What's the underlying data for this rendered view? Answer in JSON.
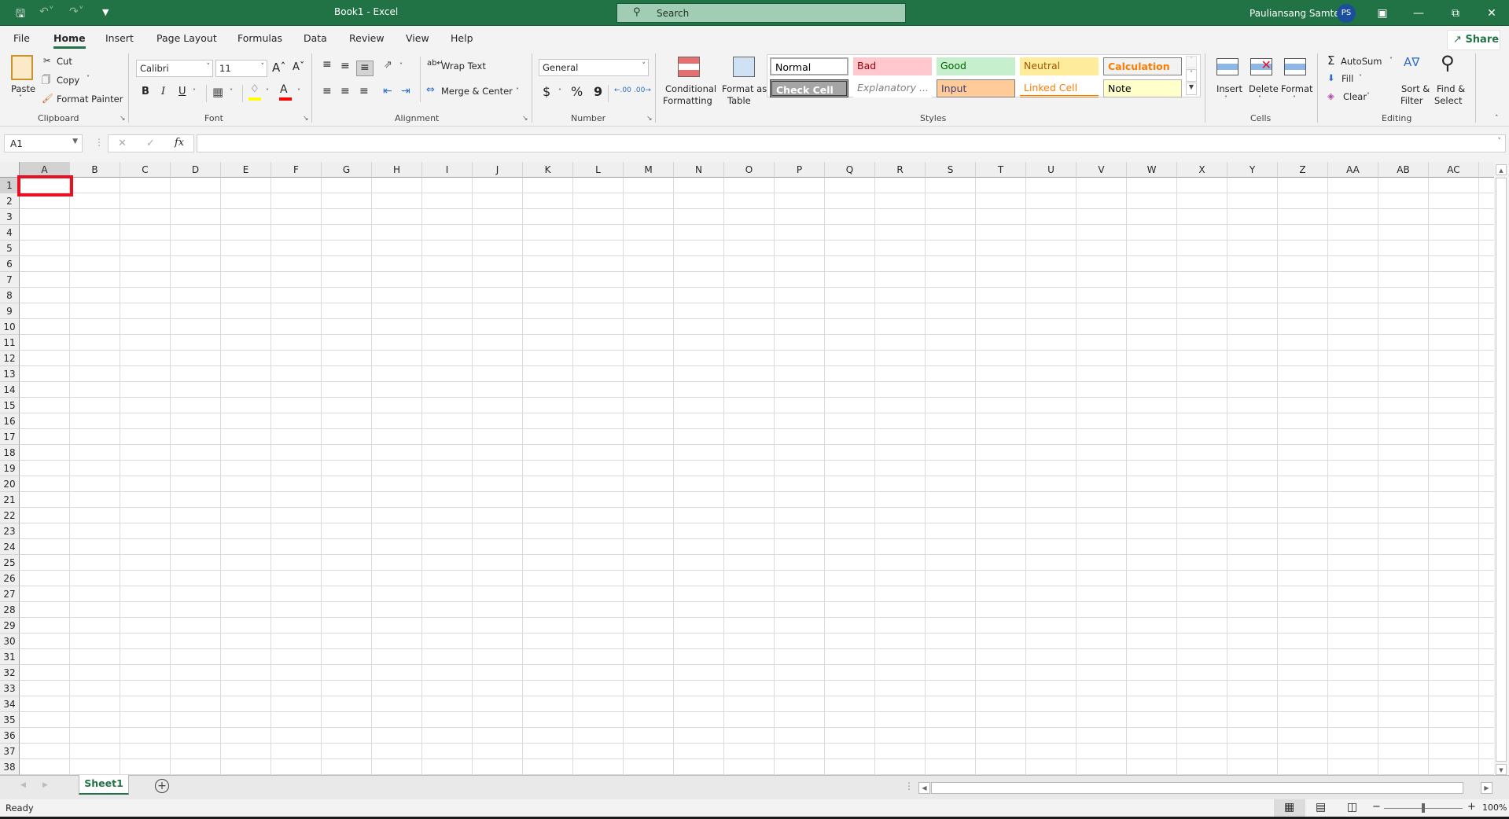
{
  "titlebar": {
    "title": "Book1  -  Excel",
    "search_placeholder": "Search",
    "user_name": "Pauliansang Samte",
    "user_initials": "PS",
    "icons": {
      "save": "save-icon",
      "undo": "undo-icon",
      "redo": "redo-icon",
      "customize": "customize-qat-icon",
      "ribbon_display": "ribbon-display-options-icon",
      "minimize": "minimize-icon",
      "restore": "restore-icon",
      "close": "close-icon"
    }
  },
  "tabs": [
    {
      "label": "File",
      "active": false
    },
    {
      "label": "Home",
      "active": true
    },
    {
      "label": "Insert",
      "active": false
    },
    {
      "label": "Page Layout",
      "active": false
    },
    {
      "label": "Formulas",
      "active": false
    },
    {
      "label": "Data",
      "active": false
    },
    {
      "label": "Review",
      "active": false
    },
    {
      "label": "View",
      "active": false
    },
    {
      "label": "Help",
      "active": false
    }
  ],
  "share_label": "Share",
  "ribbon": {
    "clipboard": {
      "label": "Clipboard",
      "paste": "Paste",
      "cut": "Cut",
      "copy": "Copy",
      "format_painter": "Format Painter"
    },
    "font": {
      "label": "Font",
      "font_name": "Calibri",
      "font_size": "11",
      "bold": "B",
      "italic": "I",
      "underline": "U",
      "fill_color": "#ffff00",
      "font_color": "#ff0000"
    },
    "alignment": {
      "label": "Alignment",
      "wrap_text": "Wrap Text",
      "merge_center": "Merge & Center"
    },
    "number": {
      "label": "Number",
      "format": "General",
      "currency": "$",
      "percent": "%",
      "comma": "9"
    },
    "styles": {
      "label": "Styles",
      "conditional_formatting": [
        "Conditional",
        "Formatting"
      ],
      "format_as_table": [
        "Format as",
        "Table"
      ],
      "gallery": [
        {
          "name": "Normal",
          "bg": "#ffffff",
          "color": "#000000"
        },
        {
          "name": "Bad",
          "bg": "#ffc7ce",
          "color": "#9c0006"
        },
        {
          "name": "Good",
          "bg": "#c6efce",
          "color": "#006100"
        },
        {
          "name": "Neutral",
          "bg": "#ffeb9c",
          "color": "#9c5700"
        },
        {
          "name": "Calculation",
          "bg": "#f2f2f2",
          "color": "#fa7d00"
        },
        {
          "name": "Check Cell",
          "bg": "#a5a5a5",
          "color": "#ffffff"
        },
        {
          "name": "Explanatory ...",
          "bg": "#ffffff",
          "color": "#7f7f7f"
        },
        {
          "name": "Input",
          "bg": "#ffcc99",
          "color": "#3f3f76"
        },
        {
          "name": "Linked Cell",
          "bg": "#ffffff",
          "color": "#fa7d00"
        },
        {
          "name": "Note",
          "bg": "#ffffcc",
          "color": "#000000"
        }
      ]
    },
    "cells": {
      "label": "Cells",
      "insert": "Insert",
      "delete": "Delete",
      "format": "Format"
    },
    "editing": {
      "label": "Editing",
      "autosum": "AutoSum",
      "fill": "Fill",
      "clear": "Clear",
      "sort_filter": [
        "Sort &",
        "Filter"
      ],
      "find_select": [
        "Find &",
        "Select"
      ]
    }
  },
  "formula_bar": {
    "name_box": "A1",
    "formula": "",
    "fx": "fx"
  },
  "grid": {
    "columns": [
      "A",
      "B",
      "C",
      "D",
      "E",
      "F",
      "G",
      "H",
      "I",
      "J",
      "K",
      "L",
      "M",
      "N",
      "O",
      "P",
      "Q",
      "R",
      "S",
      "T",
      "U",
      "V",
      "W",
      "X",
      "Y",
      "Z",
      "AA",
      "AB",
      "AC",
      ""
    ],
    "rows": 38,
    "selected_cell": "A1"
  },
  "sheets": [
    {
      "name": "Sheet1",
      "active": true
    }
  ],
  "status": {
    "text": "Ready",
    "zoom": "100%"
  }
}
